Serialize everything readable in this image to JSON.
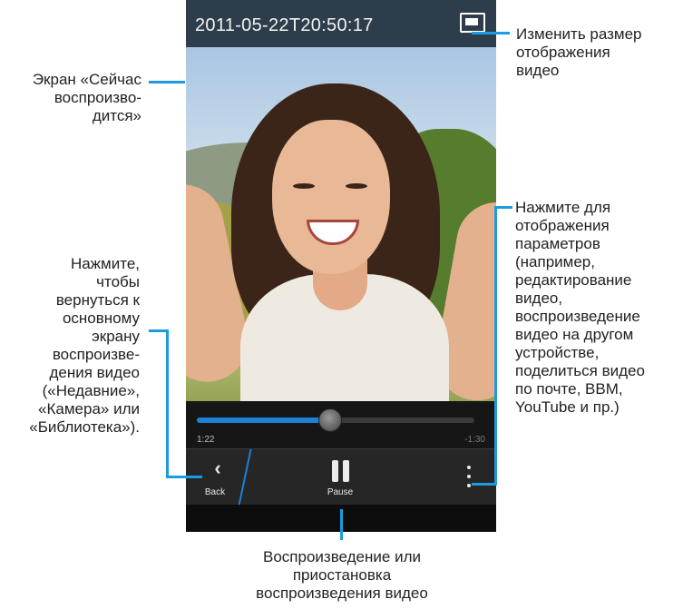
{
  "screen": {
    "timestamp": "2011-05-22T20:50:17",
    "playback": {
      "elapsed": "1:22",
      "remaining": "-1:30",
      "progress_fraction": 0.48
    },
    "action_bar": {
      "back_label": "Back",
      "pause_label": "Pause"
    }
  },
  "callouts": {
    "now_playing": "Экран «Сейчас\nвоспроизво-\nдится»",
    "resize": "Изменить размер\nотображения\nвидео",
    "back": "Нажмите,\nчтобы\nвернуться к\nосновному\nэкрану\nвоспроизве-\nдения видео\n(«Недавние»,\n«Камера» или\n«Библиотека»).",
    "options": "Нажмите для\nотображения\nпараметров\n(например,\nредактирование\nвидео,\nвоспроизведение\nвидео на другом\nустройстве,\nподелиться видео\nпо почте, BBM,\nYouTube и пр.)",
    "pause": "Воспроизведение или\nприостановка\nвоспроизведения видео"
  },
  "colors": {
    "accent": "#1d9be0",
    "title_bar": "#2e3d4b",
    "progress": "#1d82d6"
  },
  "icons": [
    "resize-icon",
    "back-icon",
    "pause-icon",
    "more-options-icon"
  ]
}
